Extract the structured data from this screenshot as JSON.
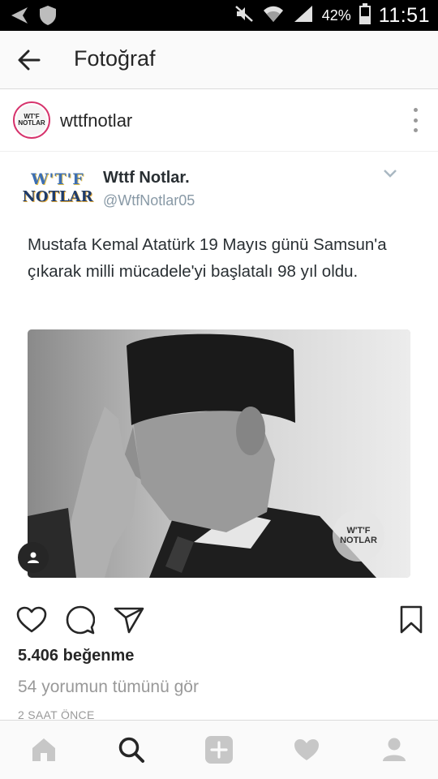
{
  "status_bar": {
    "battery_percent": "42%",
    "time": "11:51",
    "icons": [
      "back-arrow-icon",
      "shield-icon",
      "mute-icon",
      "wifi-icon",
      "signal-icon",
      "battery-icon"
    ]
  },
  "app_bar": {
    "title": "Fotoğraf",
    "back_icon": "arrow-left-icon"
  },
  "post_header": {
    "username": "wttfnotlar",
    "avatar_text": [
      "WT'F",
      "NOTLAR"
    ],
    "menu_icon": "more-vertical-icon"
  },
  "tweet": {
    "display_name": "Wttf Notlar.",
    "handle": "@WtfNotlar05",
    "avatar_logo": [
      "W'T'F",
      "NOTLAR"
    ],
    "text": "Mustafa Kemal Atatürk 19 Mayıs günü Samsun'a çıkarak milli mücadele'yi başlatalı 98 yıl oldu.",
    "photo_watermark": [
      "W'T'F",
      "NOTLAR"
    ]
  },
  "actions": {
    "icons": [
      "heart-icon",
      "comment-icon",
      "share-icon",
      "bookmark-icon"
    ]
  },
  "meta": {
    "likes": "5.406 beğenme",
    "comments_link": "54 yorumun tümünü gör",
    "time_ago": "2 SAAT ÖNCE"
  },
  "bottom_nav": {
    "items": [
      "home-icon",
      "search-icon",
      "add-icon",
      "activity-icon",
      "profile-icon"
    ],
    "active": "search-icon"
  },
  "colors": {
    "status_bar_bg": "#000000",
    "app_bar_bg": "#fafafa",
    "story_ring": "#d6336c",
    "tweet_handle": "#8899a6",
    "muted_text": "#999999"
  }
}
